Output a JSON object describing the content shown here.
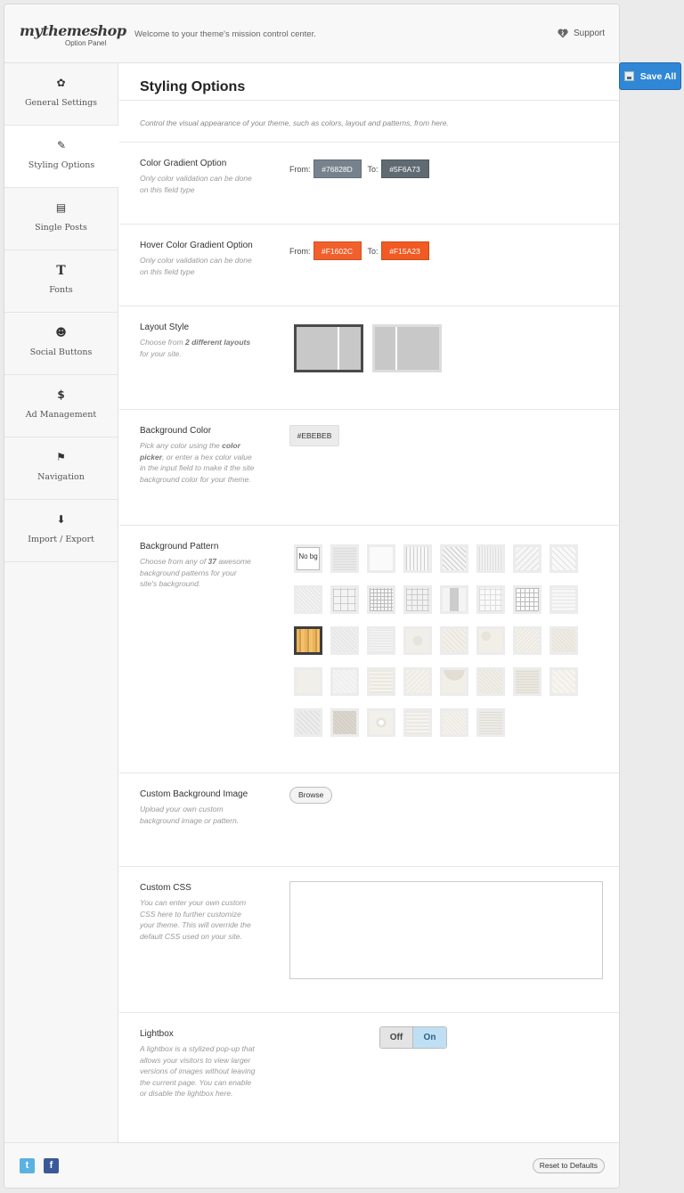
{
  "header": {
    "logo": "mythemeshop",
    "logo_sub": "Option Panel",
    "welcome": "Welcome to your theme's mission control center.",
    "support": "Support"
  },
  "save_all": "Save All",
  "sidebar": {
    "items": [
      {
        "label": "General Settings",
        "icon": "gear-icon",
        "glyph": "✿"
      },
      {
        "label": "Styling Options",
        "icon": "brush-icon",
        "glyph": "✎"
      },
      {
        "label": "Single Posts",
        "icon": "document-icon",
        "glyph": "▤"
      },
      {
        "label": "Fonts",
        "icon": "font-icon",
        "glyph": "T"
      },
      {
        "label": "Social Buttons",
        "icon": "users-icon",
        "glyph": "☻"
      },
      {
        "label": "Ad Management",
        "icon": "money-bag-icon",
        "glyph": "$"
      },
      {
        "label": "Navigation",
        "icon": "signpost-icon",
        "glyph": "⚑"
      },
      {
        "label": "Import / Export",
        "icon": "download-icon",
        "glyph": "⬇"
      }
    ],
    "active": "Styling Options"
  },
  "content": {
    "title": "Styling Options",
    "intro": "Control the visual appearance of your theme, such as colors, layout and patterns, from here.",
    "color_gradient": {
      "label": "Color Gradient Option",
      "desc": "Only color validation can be done on this field type",
      "from_label": "From:",
      "to_label": "To:",
      "from": "#76828D",
      "to": "#5F6A73"
    },
    "hover_gradient": {
      "label": "Hover Color Gradient Option",
      "desc": "Only color validation can be done on this field type",
      "from_label": "From:",
      "to_label": "To:",
      "from": "#F1602C",
      "to": "#F15A23"
    },
    "layout": {
      "label": "Layout Style",
      "desc_pre": "Choose from ",
      "desc_bold": "2 different layouts",
      "desc_post": " for your site.",
      "selected": 1
    },
    "bg_color": {
      "label": "Background Color",
      "desc_pre": "Pick any color using the ",
      "desc_bold": "color picker",
      "desc_post": ", or enter a hex color value in the input field to make it the site background color for your theme.",
      "value": "#EBEBEB"
    },
    "bg_pattern": {
      "label": "Background Pattern",
      "desc_pre": "Choose from any of ",
      "desc_bold": "37",
      "desc_post": " awesome background patterns for your site's background.",
      "no_bg": "No bg",
      "count": 37,
      "selected": 16
    },
    "custom_bg": {
      "label": "Custom Background Image",
      "desc": "Upload your own custom background image or pattern.",
      "button": "Browse"
    },
    "custom_css": {
      "label": "Custom CSS",
      "desc": "You can enter your own custom CSS here to further customize your theme. This will override the default CSS used on your site.",
      "value": ""
    },
    "lightbox": {
      "label": "Lightbox",
      "desc": "A lightbox is a stylized pop-up that allows your visitors to view larger versions of images without leaving the current page. You can enable or disable the lightbox here.",
      "off": "Off",
      "on": "On",
      "state": "On"
    }
  },
  "footer": {
    "twitter": "t",
    "facebook": "f",
    "reset": "Reset to Defaults"
  }
}
